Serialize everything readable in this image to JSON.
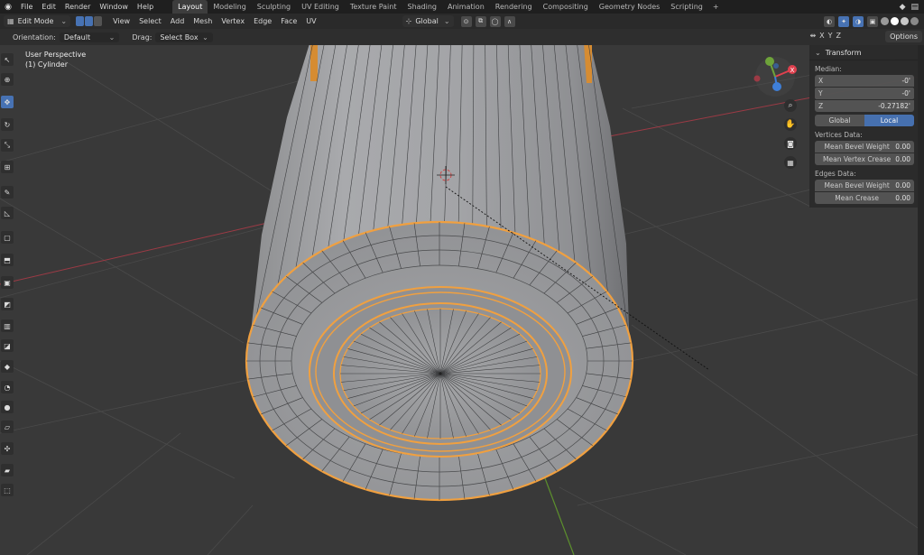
{
  "topbar": {
    "menus": [
      "File",
      "Edit",
      "Render",
      "Window",
      "Help"
    ],
    "workspaces": [
      "Layout",
      "Modeling",
      "Sculpting",
      "UV Editing",
      "Texture Paint",
      "Shading",
      "Animation",
      "Rendering",
      "Compositing",
      "Geometry Nodes",
      "Scripting"
    ],
    "active_workspace": "Layout",
    "add_tab": "+"
  },
  "header": {
    "mode": "Edit Mode",
    "menus": [
      "View",
      "Select",
      "Add",
      "Mesh",
      "Vertex",
      "Edge",
      "Face",
      "UV"
    ],
    "transform_orientation": "Global"
  },
  "toolsettings": {
    "orientation_label": "Orientation:",
    "orientation_value": "Default",
    "drag_label": "Drag:",
    "drag_value": "Select Box",
    "axes": [
      "X",
      "Y",
      "Z"
    ],
    "options_label": "Options"
  },
  "viewport": {
    "view_name": "User Perspective",
    "object_name": "(1) Cylinder"
  },
  "gizmo": {
    "x_label": "X",
    "y_label": "Y",
    "z_label": "Z",
    "x_color": "#e0404e",
    "y_color": "#6ea33a",
    "z_color": "#3f7fd8"
  },
  "npanel": {
    "title": "Transform",
    "median_label": "Median:",
    "x_label": "X",
    "x_value": "-0'",
    "y_label": "Y",
    "y_value": "-0'",
    "z_label": "Z",
    "z_value": "-0.27182'",
    "global_label": "Global",
    "local_label": "Local",
    "vertices_label": "Vertices Data:",
    "mean_bevel_weight_label": "Mean Bevel Weight",
    "mean_bevel_weight_value": "0.00",
    "mean_vertex_crease_label": "Mean Vertex Crease",
    "mean_vertex_crease_value": "0.00",
    "edges_label": "Edges Data:",
    "edge_bevel_weight_label": "Mean Bevel Weight",
    "edge_bevel_weight_value": "0.00",
    "mean_crease_label": "Mean Crease",
    "mean_crease_value": "0.00"
  },
  "colors": {
    "accent": "#4772b3",
    "selection": "#f0a040",
    "background": "#393939"
  }
}
